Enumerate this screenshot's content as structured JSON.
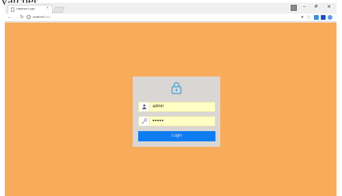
{
  "top_strip_text": "vatcher.",
  "browser": {
    "tab_title": "Halaman Login",
    "tab_close": "×",
    "url_host": "localhost",
    "url_path": "/smp/",
    "window_controls": [
      "–",
      "ø",
      "✕"
    ]
  },
  "login": {
    "username_value": "admin",
    "password_value": "•••••",
    "login_label": "Login"
  },
  "colors": {
    "page_bg": "#f8ab5b",
    "card_bg": "#dad6d3",
    "field_bg": "#ffffc4",
    "button_bg": "#0f7cf2",
    "lock_icon": "#3a9bd6"
  },
  "icons": {
    "card": "padlock-icon",
    "username": "user-icon",
    "password": "key-icon"
  }
}
